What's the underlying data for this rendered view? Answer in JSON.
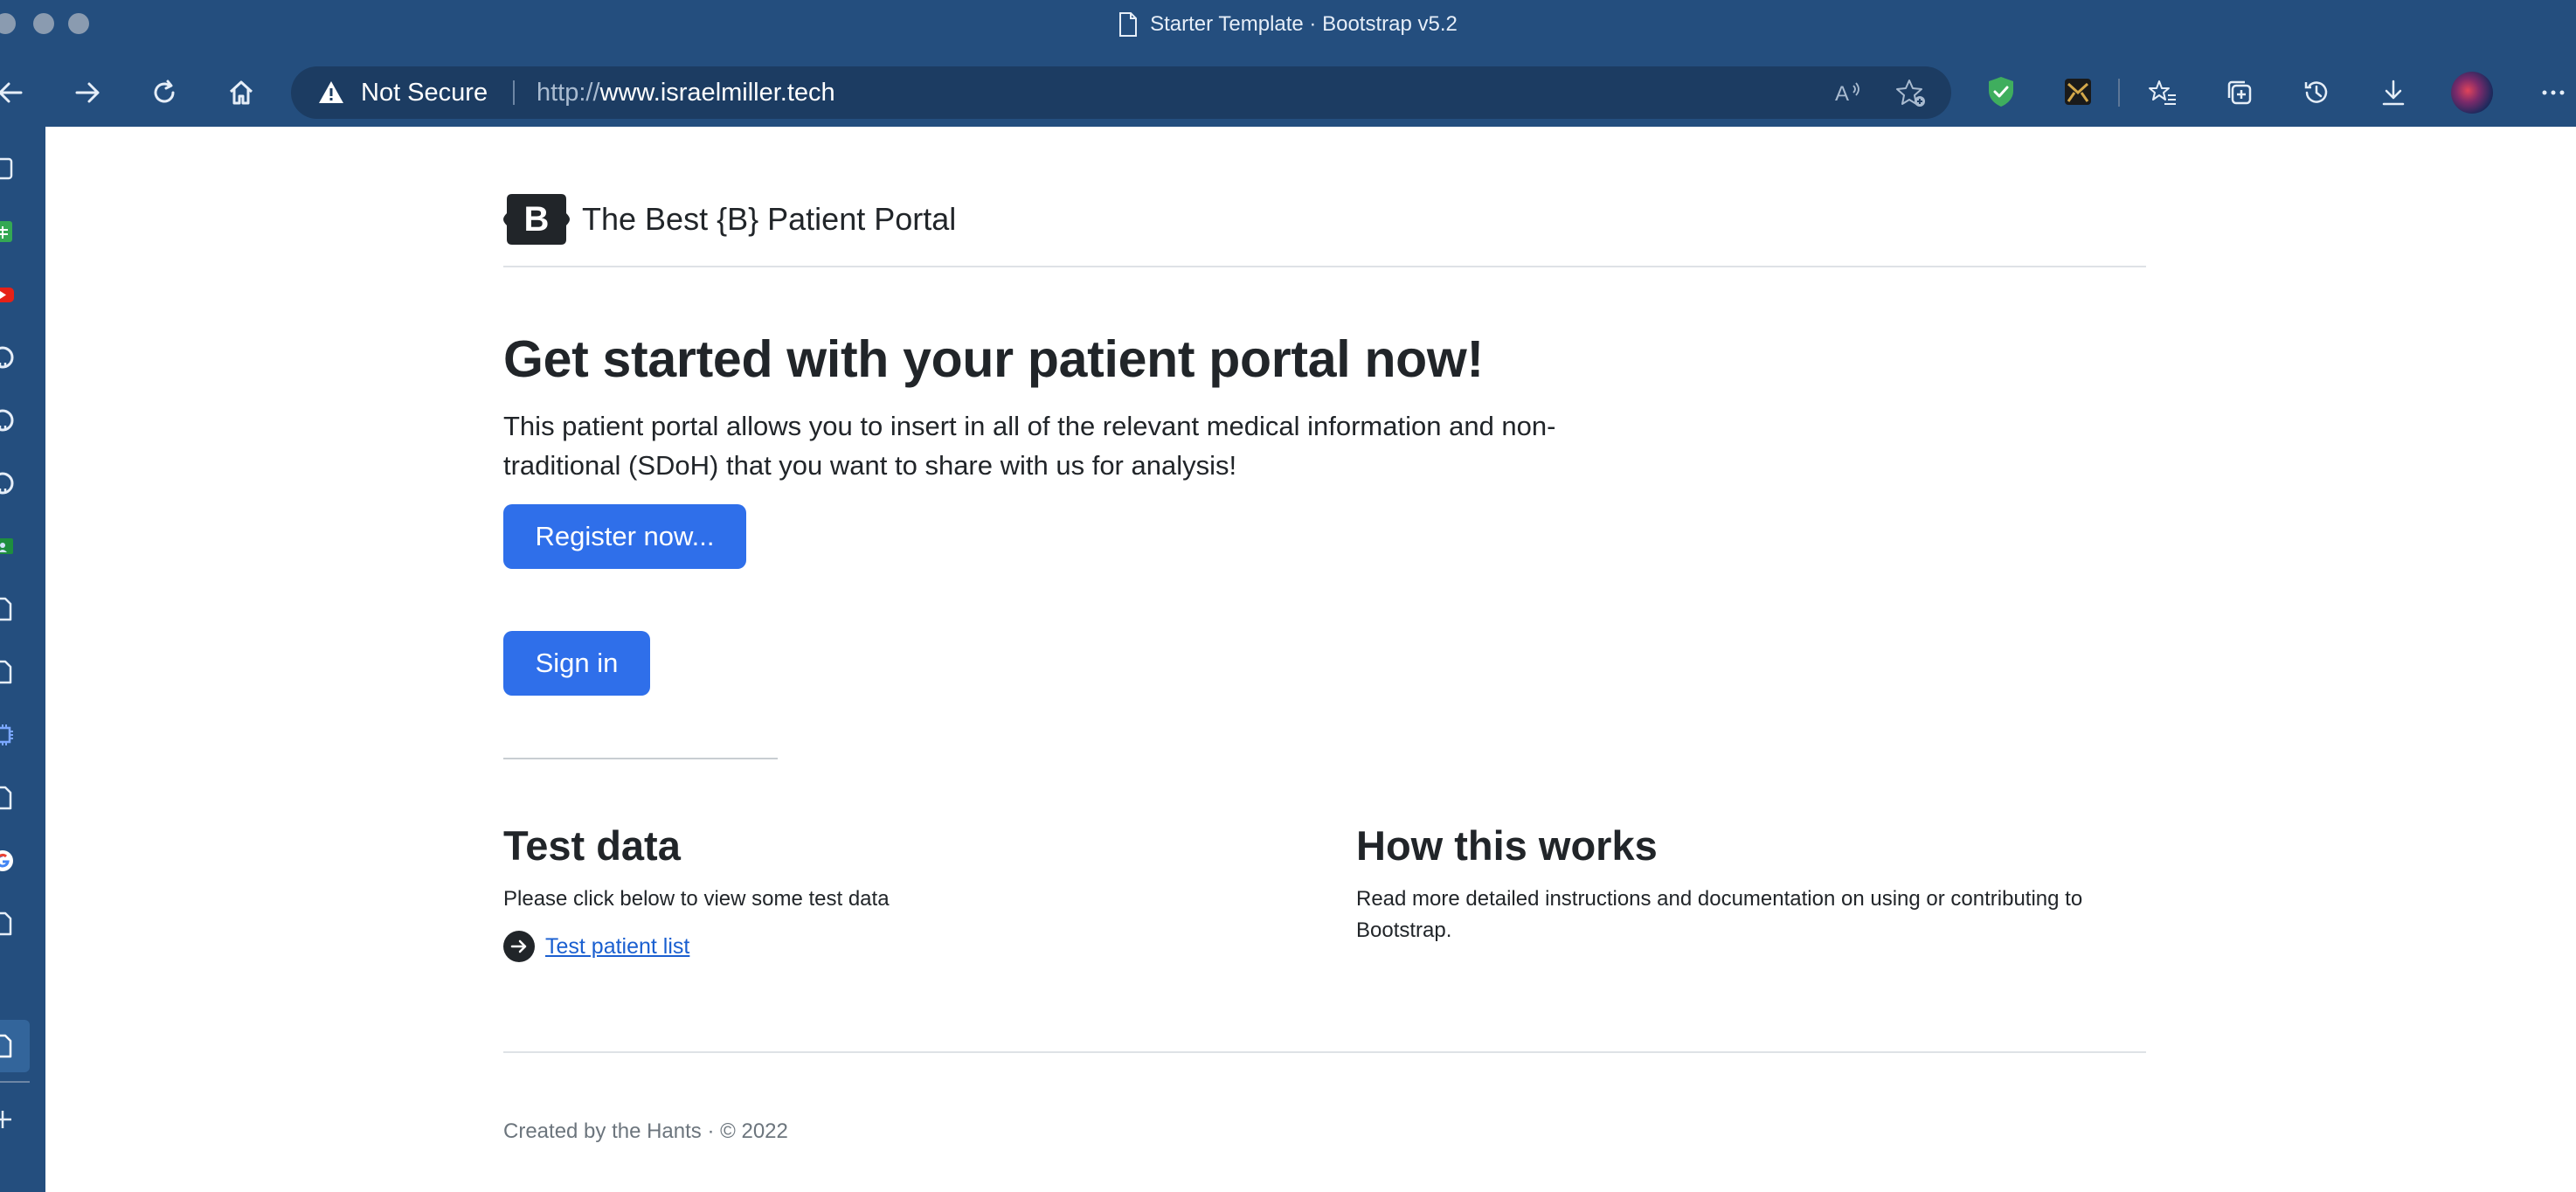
{
  "window": {
    "title": "Starter Template · Bootstrap v5.2"
  },
  "addressbar": {
    "security_label": "Not Secure",
    "url_protocol": "http://",
    "url_host": "www.israelmiller.tech"
  },
  "toolbar": {
    "icons": [
      "back-icon",
      "forward-icon",
      "refresh-icon",
      "home-icon",
      "read-aloud-icon",
      "add-favorite-icon",
      "shield-extension-icon",
      "extension-icon",
      "favorites-icon",
      "collections-icon",
      "history-icon",
      "downloads-icon",
      "profile-avatar",
      "more-icon"
    ]
  },
  "sidebar": {
    "items": [
      "page-icon",
      "sheets-icon",
      "youtube-icon",
      "github-icon",
      "github-icon",
      "github-icon",
      "classroom-icon",
      "page-icon",
      "page-icon",
      "chip-icon",
      "page-icon",
      "google-icon",
      "page-icon"
    ],
    "add_icon": "plus-icon"
  },
  "brand": {
    "logo_letter": "B",
    "name": "The Best {B} Patient Portal"
  },
  "hero": {
    "title": "Get started with your patient portal now!",
    "lead": "This patient portal allows you to insert in all of the relevant medical information and non-traditional (SDoH) that you want to share with us for analysis!",
    "register_label": "Register now...",
    "signin_label": "Sign in"
  },
  "test_data": {
    "heading": "Test data",
    "text": "Please click below to view some test data",
    "link_label": "Test patient list"
  },
  "how": {
    "heading": "How this works",
    "text": "Read more detailed instructions and documentation on using or contributing to Bootstrap."
  },
  "footer": {
    "text": "Created by the Hants · © 2022"
  },
  "colors": {
    "chrome": "#244e7e",
    "addressbar": "#1c3c62",
    "primary": "#2f6fea",
    "link": "#1a5fd0",
    "shield": "#3fae5e"
  }
}
